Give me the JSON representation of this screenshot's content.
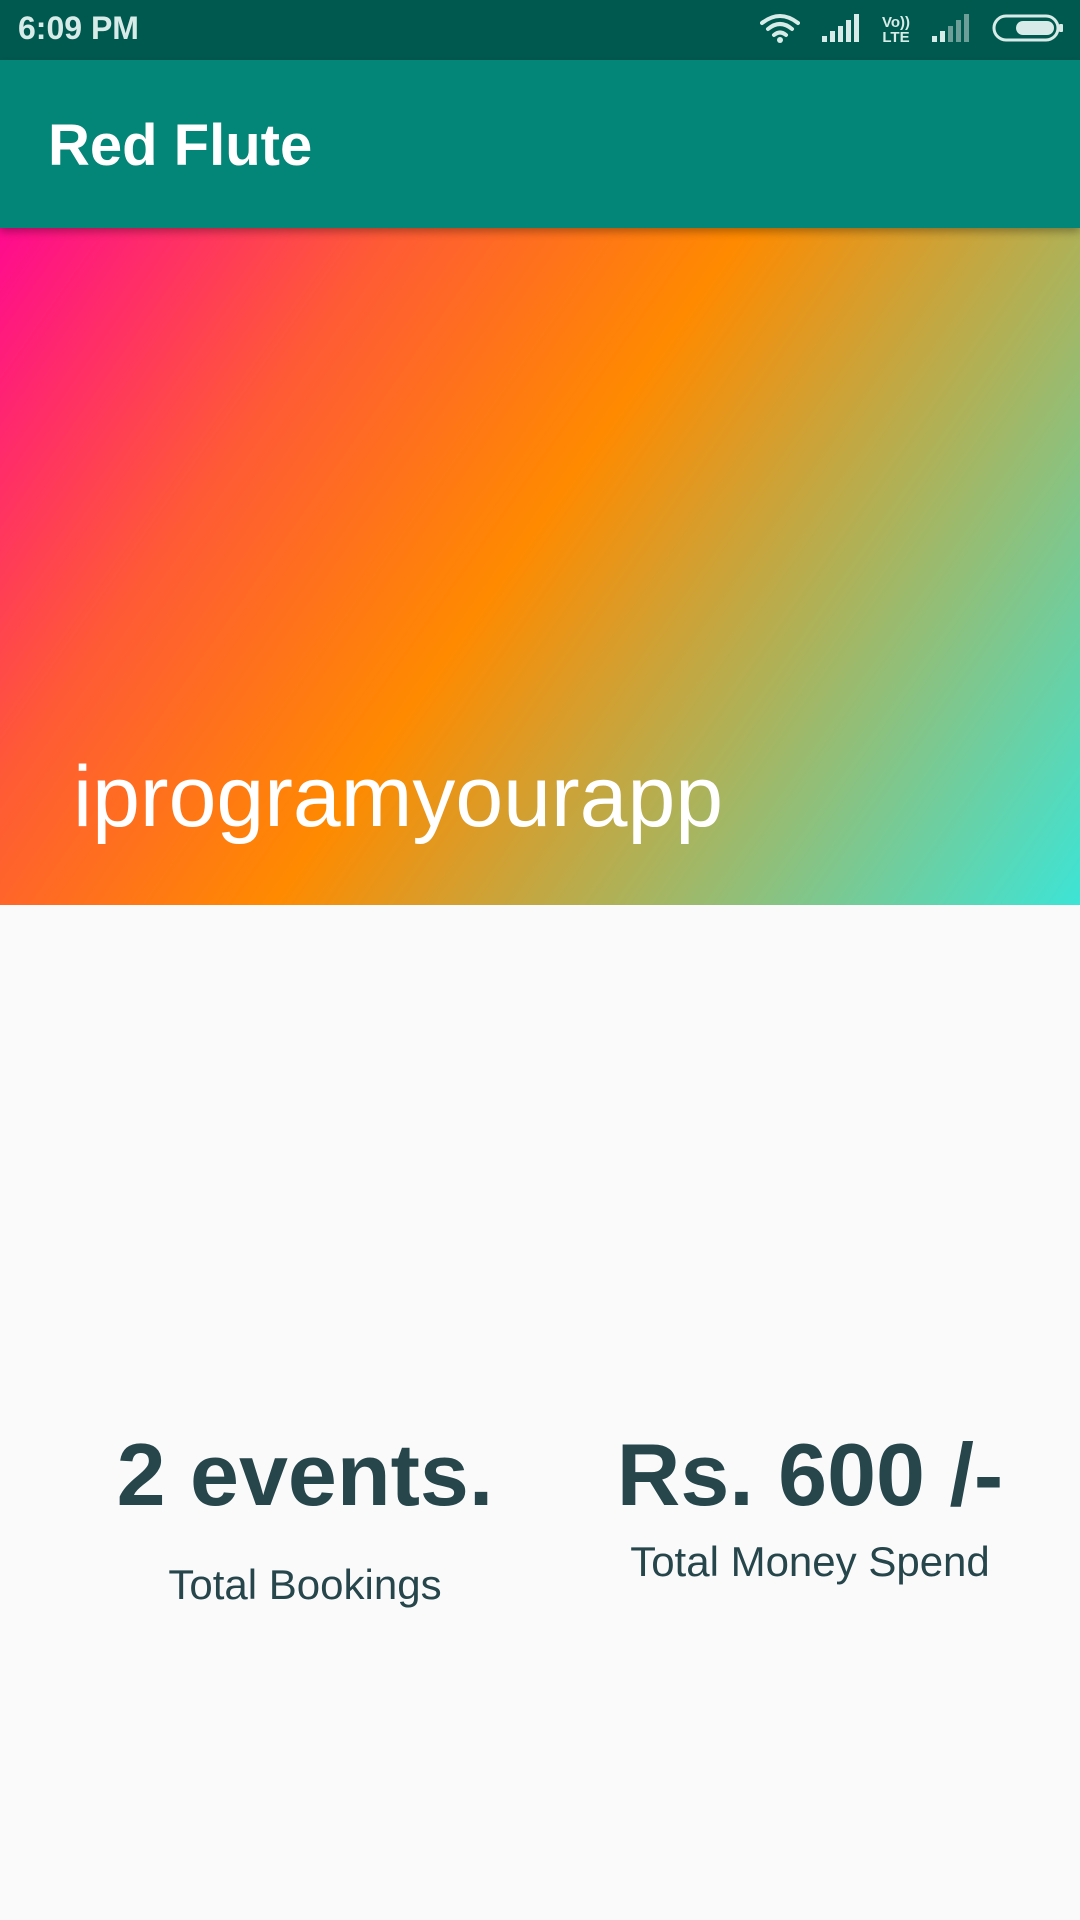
{
  "status_bar": {
    "time": "6:09 PM",
    "icons": [
      "wifi-icon",
      "cell-signal-icon",
      "volte-lte-icon",
      "cell-signal-weak-icon",
      "battery-icon"
    ],
    "lte_top": "Vo))",
    "lte_bottom": "LTE"
  },
  "app_bar": {
    "title": "Red Flute"
  },
  "banner": {
    "text": "iprogramyourapp",
    "gradient_colors": [
      "#ff0a8f",
      "#ff5a36",
      "#ff8a00",
      "#a7b560",
      "#3de4d6"
    ]
  },
  "stats": {
    "bookings": {
      "value": "2 events.",
      "label": "Total Bookings"
    },
    "money": {
      "value": "Rs. 600 /-",
      "label": "Total Money Spend"
    }
  },
  "colors": {
    "status_bar": "#00594f",
    "app_bar": "#038677",
    "text_dark": "#26464b",
    "background": "#fafafa"
  }
}
